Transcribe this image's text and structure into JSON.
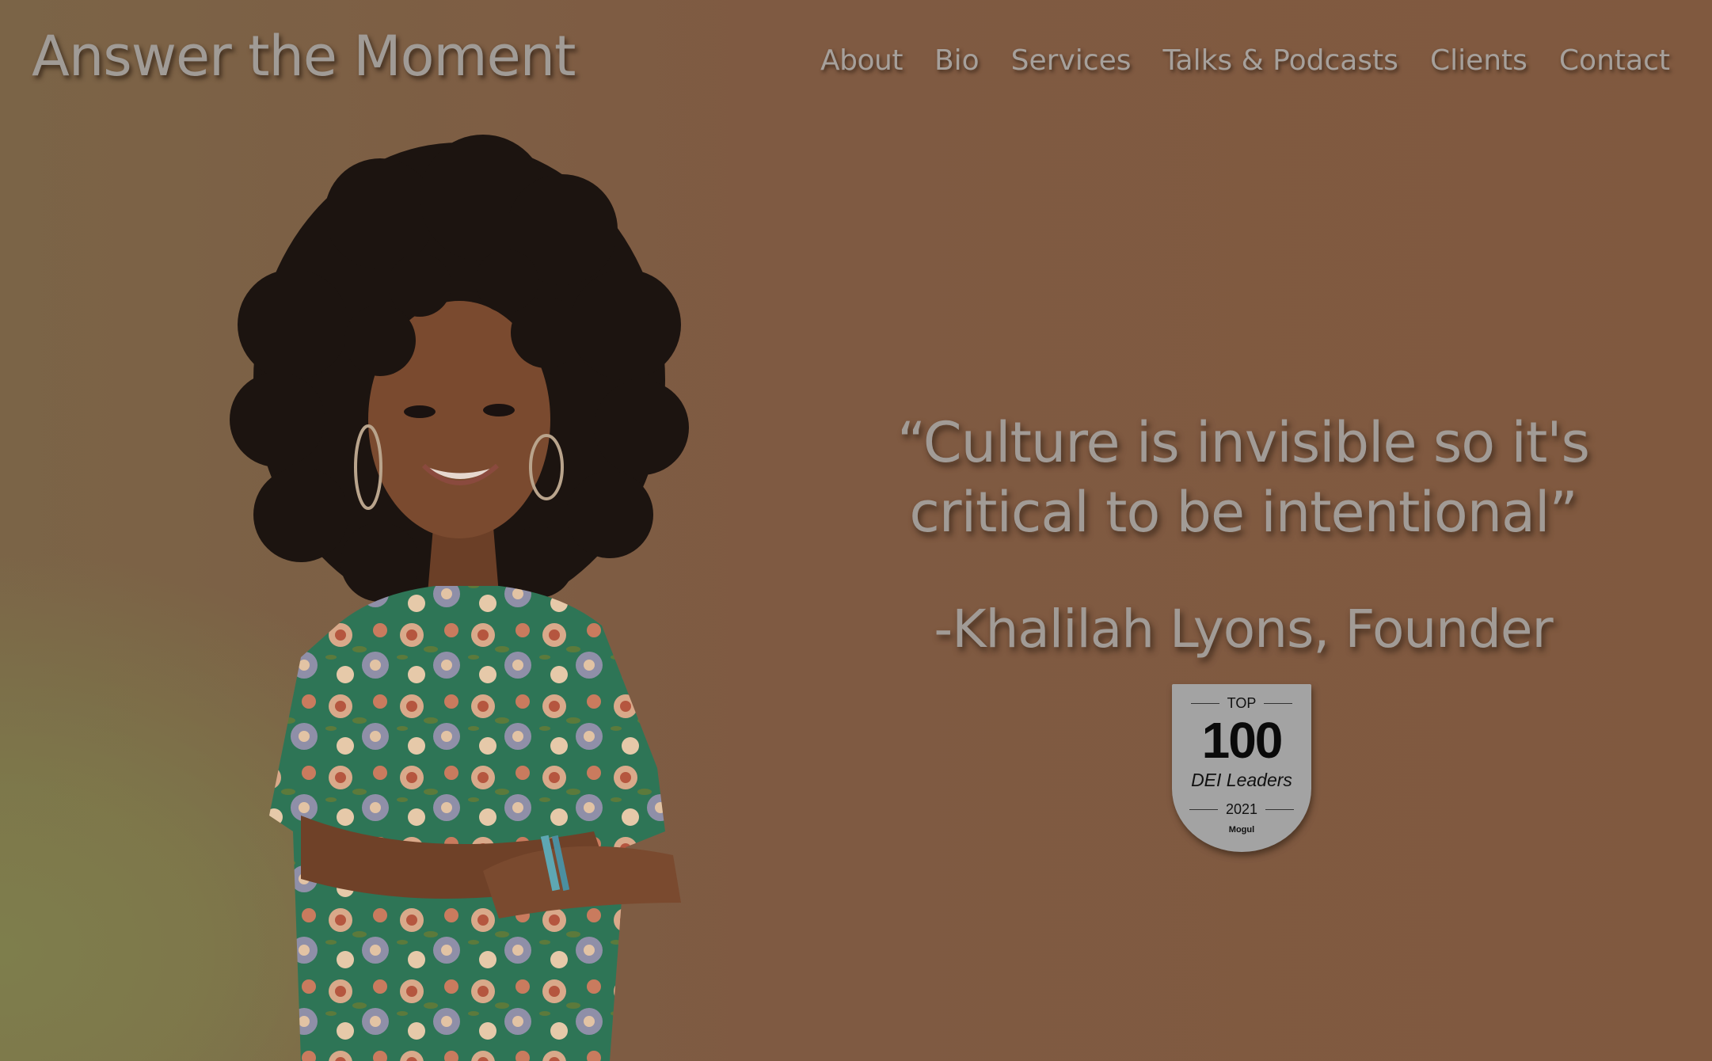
{
  "header": {
    "site_title": "Answer the Moment"
  },
  "nav": {
    "items": [
      {
        "label": "About"
      },
      {
        "label": "Bio"
      },
      {
        "label": "Services"
      },
      {
        "label": "Talks & Podcasts"
      },
      {
        "label": "Clients"
      },
      {
        "label": "Contact"
      }
    ]
  },
  "hero": {
    "quote_line1": "“Culture is invisible so it's",
    "quote_line2": "critical to be intentional”",
    "attribution": "-Khalilah Lyons, Founder"
  },
  "badge": {
    "top_label": "TOP",
    "number": "100",
    "label": "DEI Leaders",
    "year": "2021",
    "brand": "Mogul"
  },
  "colors": {
    "background": "#7f5a42",
    "background_glow": "#7e7e4c",
    "text": "#a19b96",
    "dress_green": "#2e7556",
    "badge": "#a3a3a3"
  }
}
